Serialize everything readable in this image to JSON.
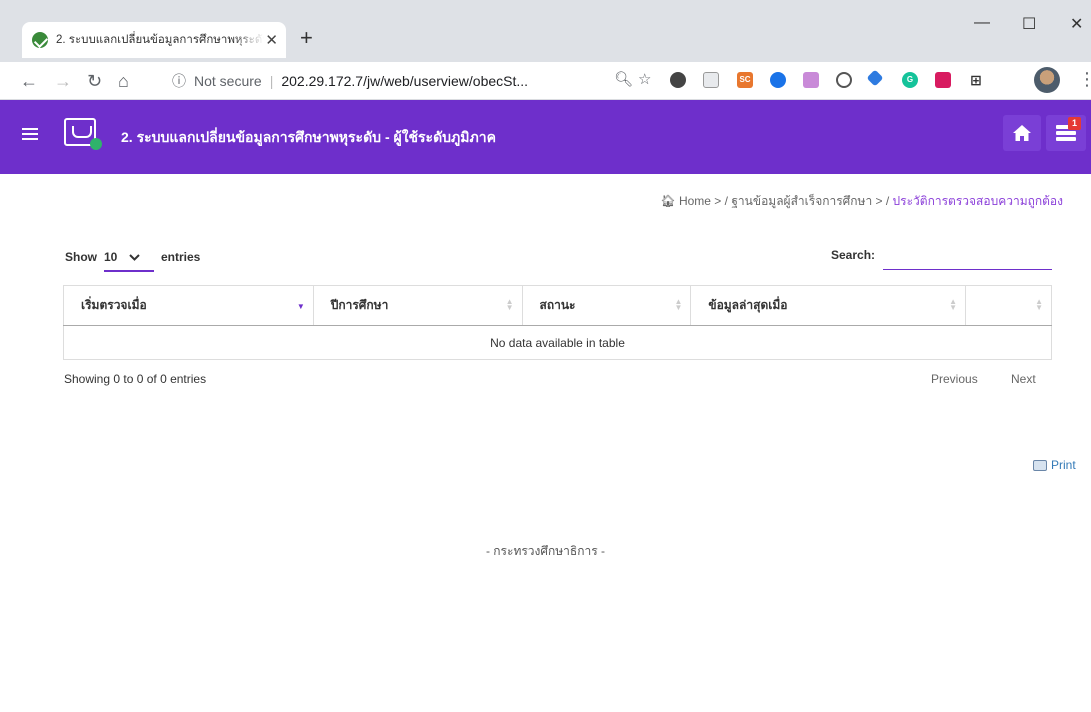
{
  "browser": {
    "tab_title": "2. ระบบแลกเปลี่ยนข้อมูลการศึกษาพหุระดับ",
    "tab_close": "✕",
    "new_tab": "+",
    "address": {
      "security": "Not secure",
      "url": "202.29.172.7/jw/web/userview/obecSt..."
    }
  },
  "app": {
    "title": "2. ระบบแลกเปลี่ยนข้อมูลการศึกษาพหุระดับ - ผู้ใช้ระดับภูมิภาค",
    "notification_count": "1",
    "accent_color": "#6e2fcb"
  },
  "breadcrumb": {
    "home": "Home",
    "sep": " > / ",
    "level2": "ฐานข้อมูลผู้สำเร็จการศึกษา",
    "current": "ประวัติการตรวจสอบความถูกต้อง"
  },
  "table_controls": {
    "show_label": "Show",
    "page_length": "10",
    "entries_label": "entries",
    "search_label": "Search:",
    "search_value": ""
  },
  "table": {
    "columns": [
      "เริ่มตรวจเมื่อ",
      "ปีการศึกษา",
      "สถานะ",
      "ข้อมูลล่าสุดเมื่อ",
      ""
    ],
    "empty_message": "No data available in table"
  },
  "pagination": {
    "info": "Showing 0 to 0 of 0 entries",
    "previous": "Previous",
    "next": "Next"
  },
  "print_label": "Print",
  "footer": "- กระทรวงศึกษาธิการ -"
}
